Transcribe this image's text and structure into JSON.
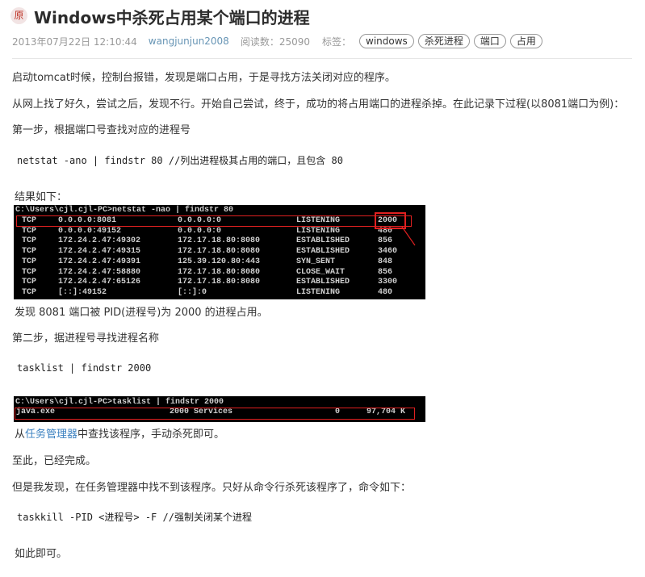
{
  "header": {
    "original_badge": "原",
    "title": "Windows中杀死占用某个端口的进程",
    "date": "2013年07月22日 12:10:44",
    "author": "wangjunjun2008",
    "views": "阅读数：25090",
    "tags_label": "标签：",
    "tags": [
      "windows",
      "杀死进程",
      "端口",
      "占用"
    ]
  },
  "article": {
    "p1": "启动tomcat时候，控制台报错，发现是端口占用，于是寻找方法关闭对应的程序。",
    "p2": "从网上找了好久，尝试之后，发现不行。开始自己尝试，终于，成功的将占用端口的进程杀掉。在此记录下过程(以8081端口为例)：",
    "step1": "第一步，根据端口号查找对应的进程号",
    "code1": "netstat -ano | findstr 80 //列出进程极其占用的端口，且包含 80",
    "result_label": "结果如下：",
    "console1": {
      "command": "C:\\Users\\cjl.cjl-PC>netstat -nao | findstr 80",
      "rows": [
        [
          "TCP",
          "0.0.0.0:8081",
          "0.0.0.0:0",
          "LISTENING",
          "2000"
        ],
        [
          "TCP",
          "0.0.0.0:49152",
          "0.0.0.0:0",
          "LISTENING",
          "480"
        ],
        [
          "TCP",
          "172.24.2.47:49302",
          "172.17.18.80:8080",
          "ESTABLISHED",
          "856"
        ],
        [
          "TCP",
          "172.24.2.47:49315",
          "172.17.18.80:8080",
          "ESTABLISHED",
          "3460"
        ],
        [
          "TCP",
          "172.24.2.47:49391",
          "125.39.120.80:443",
          "SYN_SENT",
          "848"
        ],
        [
          "TCP",
          "172.24.2.47:58880",
          "172.17.18.80:8080",
          "CLOSE_WAIT",
          "856"
        ],
        [
          "TCP",
          "172.24.2.47:65126",
          "172.17.18.80:8080",
          "ESTABLISHED",
          "3300"
        ],
        [
          "TCP",
          "[::]:49152",
          "[::]:0",
          "LISTENING",
          "480"
        ]
      ]
    },
    "found_pid": "发现 8081 端口被 PID(进程号)为 2000 的进程占用。",
    "step2": "第二步，据进程号寻找进程名称",
    "code2": "tasklist | findstr 2000",
    "console2": {
      "command": "C:\\Users\\cjl.cjl-PC>tasklist | findstr 2000",
      "row": [
        "java.exe",
        "2000 Services",
        "0",
        "97,704 K"
      ]
    },
    "p_task_pre": "从",
    "p_task_link": "任务管理器",
    "p_task_post": "中查找该程序，手动杀死即可。",
    "p_done": "至此，已经完成。",
    "p_but": "但是我发现，在任务管理器中找不到该程序。只好从命令行杀死该程序了，命令如下：",
    "code3": "taskkill -PID <进程号> -F //强制关闭某个进程",
    "p_end": "如此即可。"
  }
}
